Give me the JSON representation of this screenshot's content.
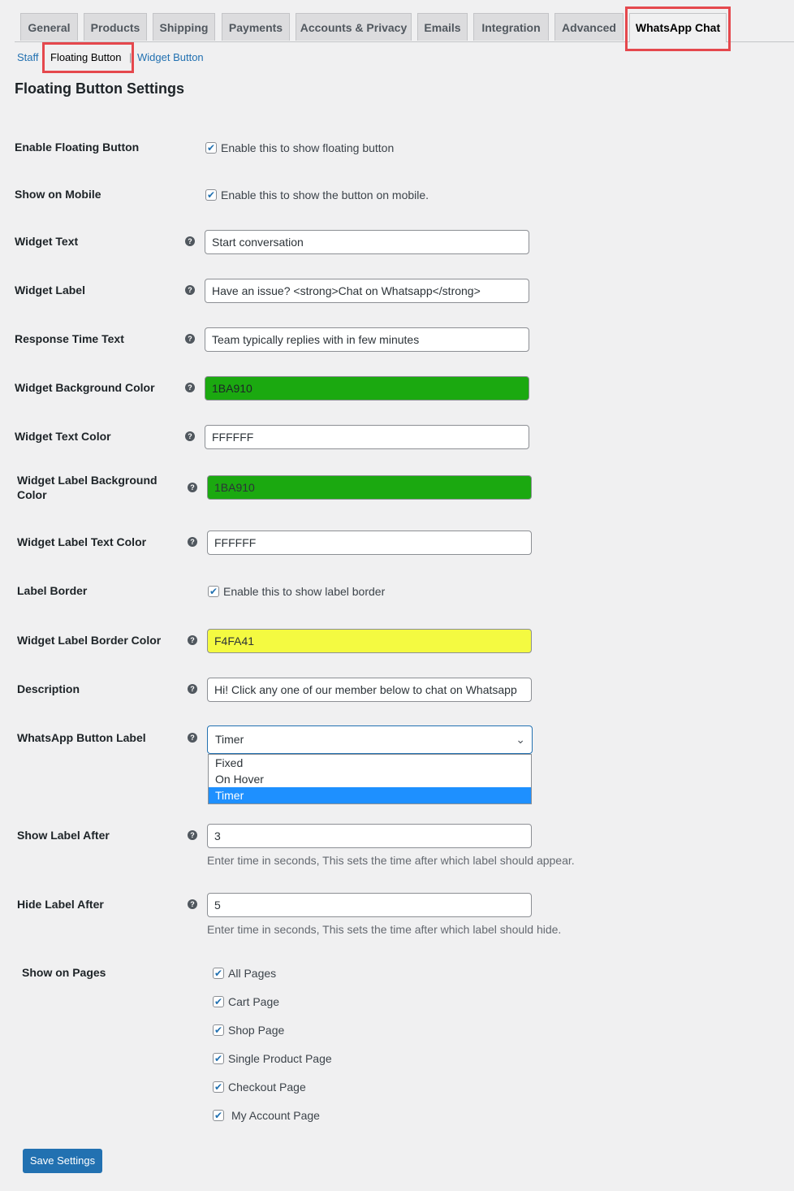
{
  "tabs": [
    "General",
    "Products",
    "Shipping",
    "Payments",
    "Accounts & Privacy",
    "Emails",
    "Integration",
    "Advanced",
    "WhatsApp Chat"
  ],
  "subnav": {
    "staff": "Staff",
    "floating": "Floating Button",
    "separator": "|",
    "widget": "Widget Button"
  },
  "title": "Floating Button Settings",
  "fields": {
    "enable": {
      "label": "Enable Floating Button",
      "text": "Enable this to show floating button",
      "checked": true
    },
    "mobile": {
      "label": "Show on Mobile",
      "text": "Enable this to show the button on mobile.",
      "checked": true
    },
    "widget_text": {
      "label": "Widget Text",
      "value": "Start conversation"
    },
    "widget_label": {
      "label": "Widget Label",
      "value": "Have an issue? <strong>Chat on Whatsapp</strong>"
    },
    "response": {
      "label": "Response Time Text",
      "value": "Team typically replies with in few minutes"
    },
    "bg": {
      "label": "Widget Background Color",
      "value": "1BA910"
    },
    "text_color": {
      "label": "Widget Text Color",
      "value": "FFFFFF"
    },
    "label_bg": {
      "label": "Widget Label Background Color",
      "value": "1BA910"
    },
    "label_text": {
      "label": "Widget Label Text Color",
      "value": "FFFFFF"
    },
    "border": {
      "label": "Label Border",
      "text": "Enable this to show label border",
      "checked": true
    },
    "border_color": {
      "label": "Widget Label Border Color",
      "value": "F4FA41"
    },
    "description": {
      "label": "Description",
      "value": "Hi! Click any one of our member below to chat on Whatsapp"
    },
    "button_label": {
      "label": "WhatsApp Button Label",
      "selected": "Timer",
      "options": [
        "Fixed",
        "On Hover",
        "Timer"
      ]
    },
    "show_after": {
      "label": "Show Label After",
      "value": "3",
      "hint": "Enter time in seconds, This sets the time after which label should appear."
    },
    "hide_after": {
      "label": "Hide Label After",
      "value": "5",
      "hint": "Enter time in seconds, This sets the time after which label should hide."
    },
    "pages": {
      "label": "Show on Pages",
      "items": [
        "All Pages",
        "Cart Page",
        "Shop Page",
        "Single Product Page",
        "Checkout Page",
        "My Account Page"
      ]
    }
  },
  "save": "Save Settings",
  "colors": {
    "green": "#1BA910",
    "yellow": "#F4FA41",
    "highlight": "#e5484d",
    "primary": "#2271b1"
  }
}
